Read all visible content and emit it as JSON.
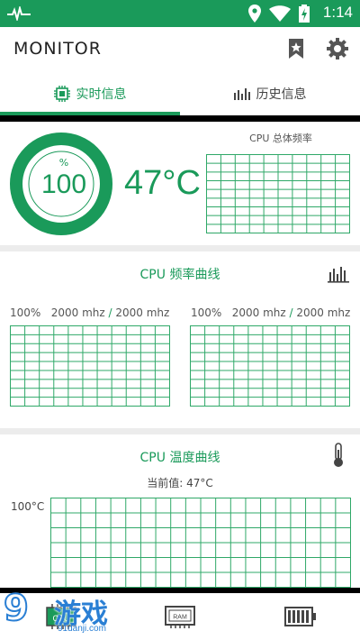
{
  "status_bar": {
    "time": "1:14"
  },
  "app_bar": {
    "title": "MONITOR"
  },
  "tabs": [
    {
      "label": "实时信息",
      "icon": "cpu-chip-icon",
      "active": true
    },
    {
      "label": "历史信息",
      "icon": "bar-chart-icon",
      "active": false
    }
  ],
  "overview": {
    "usage_unit": "%",
    "usage_value": "100",
    "usage_fraction": 1.0,
    "temperature": "47°C",
    "cpu_total_label": "CPU 总体频率"
  },
  "freq_section": {
    "title": "CPU 频率曲线",
    "cores": [
      {
        "percent": "100%",
        "current": "2000 mhz",
        "max": "2000 mhz"
      },
      {
        "percent": "100%",
        "current": "2000 mhz",
        "max": "2000 mhz"
      }
    ]
  },
  "temp_section": {
    "title": "CPU 温度曲线",
    "current_label": "当前值: 47°C",
    "y_max": "100°C"
  },
  "bottom_nav": [
    {
      "label": "CPU",
      "icon": "cpu-chip-icon"
    },
    {
      "label": "RAM",
      "icon": "ram-chip-icon"
    },
    {
      "label": "",
      "icon": "battery-icon"
    }
  ],
  "watermark": {
    "brand": "游戏",
    "number": "9",
    "url": "91danji.com"
  },
  "colors": {
    "accent": "#1a9a5a",
    "grid": "#2fa868",
    "background": "#ececec"
  }
}
